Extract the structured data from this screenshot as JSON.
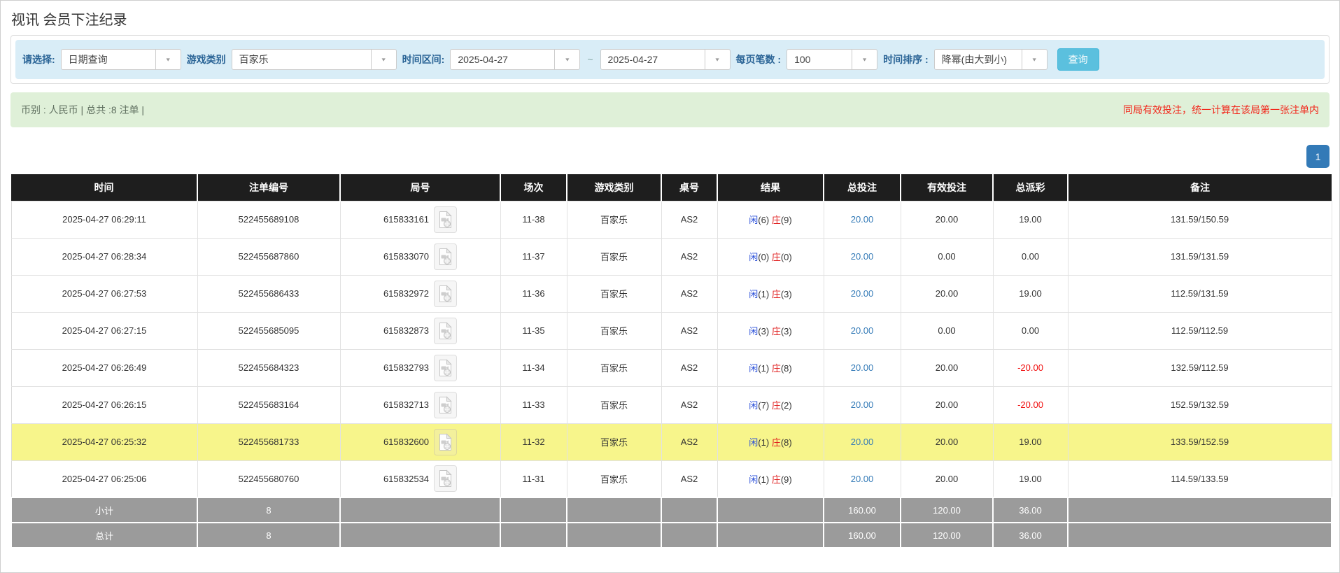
{
  "page": {
    "title": "视讯 会员下注纪录"
  },
  "colors": {
    "filter_bg": "#d9edf7",
    "label_blue": "#2a6496",
    "button_cyan": "#5bc0de",
    "summary_bg": "#dff0d8",
    "summary_text": "#5f6f5f",
    "notice_red": "#f2281c",
    "pagination_blue": "#337ab7",
    "header_black": "#1e1e1e",
    "footer_gray": "#9b9b9b",
    "highlight_yellow": "#f7f58b",
    "link_blue": "#337ab7",
    "player_blue": "#2b50d9",
    "banker_red": "#e01f1f",
    "negative_red": "#f00c0c"
  },
  "filters": {
    "query_type": {
      "label": "请选择:",
      "value": "日期查询"
    },
    "game_category": {
      "label": "游戏类别",
      "value": "百家乐"
    },
    "time_range": {
      "label": "时间区间:",
      "from": "2025-04-27",
      "separator": "~",
      "to": "2025-04-27"
    },
    "page_size": {
      "label": "每页笔数 :",
      "value": "100"
    },
    "time_sort": {
      "label": "时间排序 :",
      "value": "降幂(由大到小)"
    },
    "search_button": "查询"
  },
  "summary": {
    "left_text": "币别 : 人民币 | 总共 :8 注单 |",
    "right_notice": "同局有效投注，统一计算在该局第一张注单内"
  },
  "pagination": {
    "current_page": "1"
  },
  "table": {
    "columns": [
      "时间",
      "注单编号",
      "局号",
      "场次",
      "游戏类别",
      "桌号",
      "结果",
      "总投注",
      "有效投注",
      "总派彩",
      "备注"
    ],
    "rows": [
      {
        "time": "2025-04-27 06:29:11",
        "bet_id": "522455689108",
        "round_id": "615833161",
        "session": "11-38",
        "game": "百家乐",
        "table_no": "AS2",
        "result_player": "闲",
        "result_player_num": "(6)",
        "result_banker": "庄",
        "result_banker_num": "(9)",
        "total_bet": "20.00",
        "valid_bet": "20.00",
        "payout": "19.00",
        "payout_negative": false,
        "remark": "131.59/150.59",
        "highlight": false
      },
      {
        "time": "2025-04-27 06:28:34",
        "bet_id": "522455687860",
        "round_id": "615833070",
        "session": "11-37",
        "game": "百家乐",
        "table_no": "AS2",
        "result_player": "闲",
        "result_player_num": "(0)",
        "result_banker": "庄",
        "result_banker_num": "(0)",
        "total_bet": "20.00",
        "valid_bet": "0.00",
        "payout": "0.00",
        "payout_negative": false,
        "remark": "131.59/131.59",
        "highlight": false
      },
      {
        "time": "2025-04-27 06:27:53",
        "bet_id": "522455686433",
        "round_id": "615832972",
        "session": "11-36",
        "game": "百家乐",
        "table_no": "AS2",
        "result_player": "闲",
        "result_player_num": "(1)",
        "result_banker": "庄",
        "result_banker_num": "(3)",
        "total_bet": "20.00",
        "valid_bet": "20.00",
        "payout": "19.00",
        "payout_negative": false,
        "remark": "112.59/131.59",
        "highlight": false
      },
      {
        "time": "2025-04-27 06:27:15",
        "bet_id": "522455685095",
        "round_id": "615832873",
        "session": "11-35",
        "game": "百家乐",
        "table_no": "AS2",
        "result_player": "闲",
        "result_player_num": "(3)",
        "result_banker": "庄",
        "result_banker_num": "(3)",
        "total_bet": "20.00",
        "valid_bet": "0.00",
        "payout": "0.00",
        "payout_negative": false,
        "remark": "112.59/112.59",
        "highlight": false
      },
      {
        "time": "2025-04-27 06:26:49",
        "bet_id": "522455684323",
        "round_id": "615832793",
        "session": "11-34",
        "game": "百家乐",
        "table_no": "AS2",
        "result_player": "闲",
        "result_player_num": "(1)",
        "result_banker": "庄",
        "result_banker_num": "(8)",
        "total_bet": "20.00",
        "valid_bet": "20.00",
        "payout": "-20.00",
        "payout_negative": true,
        "remark": "132.59/112.59",
        "highlight": false
      },
      {
        "time": "2025-04-27 06:26:15",
        "bet_id": "522455683164",
        "round_id": "615832713",
        "session": "11-33",
        "game": "百家乐",
        "table_no": "AS2",
        "result_player": "闲",
        "result_player_num": "(7)",
        "result_banker": "庄",
        "result_banker_num": "(2)",
        "total_bet": "20.00",
        "valid_bet": "20.00",
        "payout": "-20.00",
        "payout_negative": true,
        "remark": "152.59/132.59",
        "highlight": false
      },
      {
        "time": "2025-04-27 06:25:32",
        "bet_id": "522455681733",
        "round_id": "615832600",
        "session": "11-32",
        "game": "百家乐",
        "table_no": "AS2",
        "result_player": "闲",
        "result_player_num": "(1)",
        "result_banker": "庄",
        "result_banker_num": "(8)",
        "total_bet": "20.00",
        "valid_bet": "20.00",
        "payout": "19.00",
        "payout_negative": false,
        "remark": "133.59/152.59",
        "highlight": true
      },
      {
        "time": "2025-04-27 06:25:06",
        "bet_id": "522455680760",
        "round_id": "615832534",
        "session": "11-31",
        "game": "百家乐",
        "table_no": "AS2",
        "result_player": "闲",
        "result_player_num": "(1)",
        "result_banker": "庄",
        "result_banker_num": "(9)",
        "total_bet": "20.00",
        "valid_bet": "20.00",
        "payout": "19.00",
        "payout_negative": false,
        "remark": "114.59/133.59",
        "highlight": false
      }
    ],
    "footer": [
      {
        "label": "小计",
        "count": "8",
        "total_bet": "160.00",
        "valid_bet": "120.00",
        "payout": "36.00"
      },
      {
        "label": "总计",
        "count": "8",
        "total_bet": "160.00",
        "valid_bet": "120.00",
        "payout": "36.00"
      }
    ]
  }
}
